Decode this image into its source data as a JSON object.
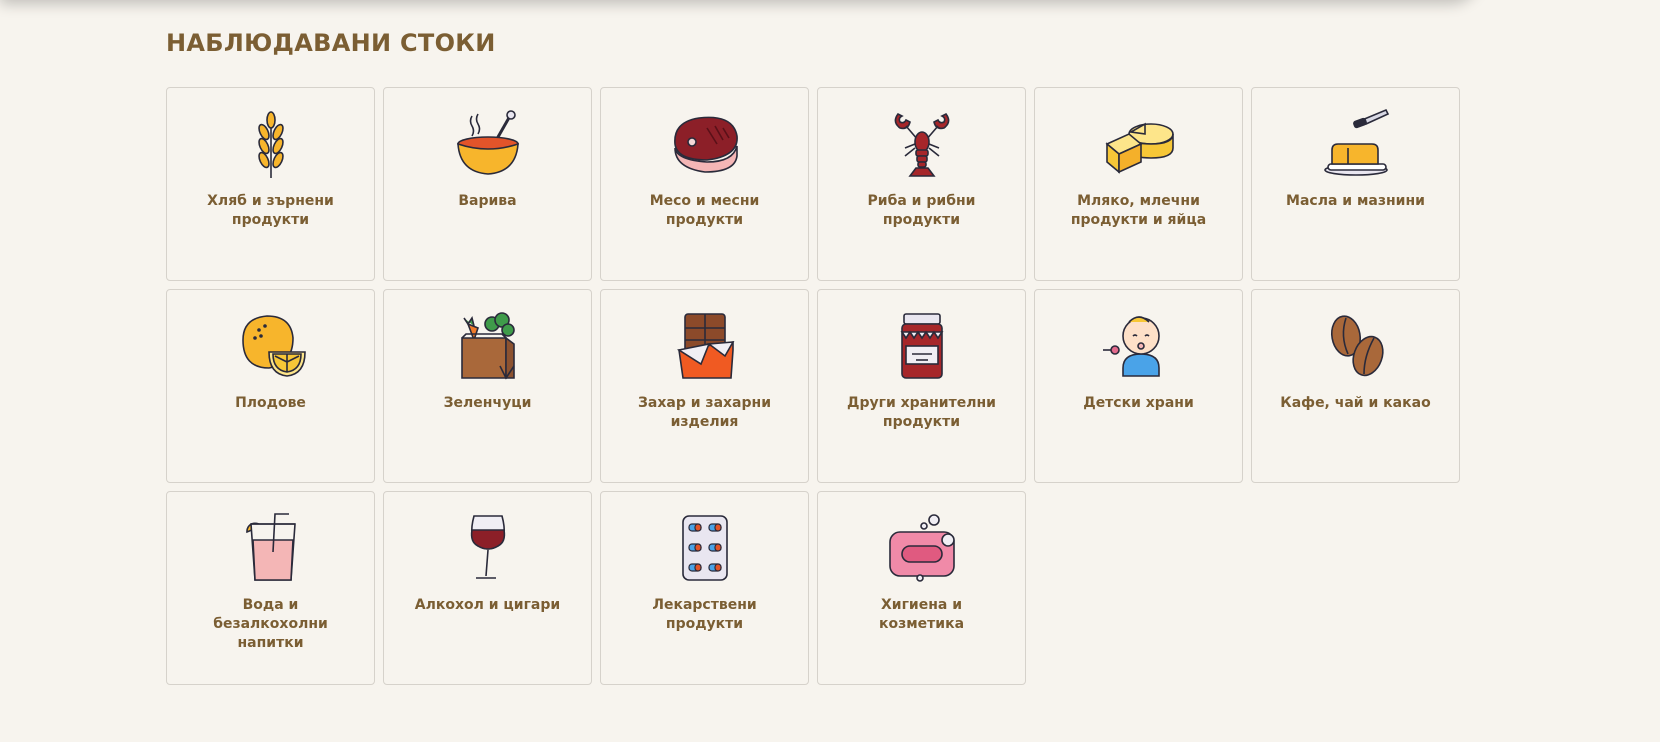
{
  "section": {
    "title": "НАБЛЮДАВАНИ СТОКИ"
  },
  "categories": [
    {
      "label": "Хляб и зърнени продукти",
      "icon": "wheat-icon"
    },
    {
      "label": "Варива",
      "icon": "soup-bowl-icon"
    },
    {
      "label": "Месо и месни продукти",
      "icon": "steak-icon"
    },
    {
      "label": "Риба и рибни продукти",
      "icon": "lobster-icon"
    },
    {
      "label": "Мляко, млечни продукти и яйца",
      "icon": "cheese-icon"
    },
    {
      "label": "Масла и мазнини",
      "icon": "butter-icon"
    },
    {
      "label": "Плодове",
      "icon": "lemon-icon"
    },
    {
      "label": "Зеленчуци",
      "icon": "vegetable-bag-icon"
    },
    {
      "label": "Захар и захарни изделия",
      "icon": "chocolate-bar-icon"
    },
    {
      "label": "Други хранителни продукти",
      "icon": "jam-jar-icon"
    },
    {
      "label": "Детски храни",
      "icon": "baby-icon"
    },
    {
      "label": "Кафе, чай и какао",
      "icon": "coffee-beans-icon"
    },
    {
      "label": "Вода и безалкохолни напитки",
      "icon": "drink-glass-icon"
    },
    {
      "label": "Алкохол и цигари",
      "icon": "wine-glass-icon"
    },
    {
      "label": "Лекарствени продукти",
      "icon": "pill-blister-icon"
    },
    {
      "label": "Хигиена и козметика",
      "icon": "soap-icon"
    }
  ],
  "colors": {
    "title": "#7b5e33",
    "label": "#7b5e33",
    "background": "#f7f4ee",
    "tile_border": "#d6d2cb"
  }
}
